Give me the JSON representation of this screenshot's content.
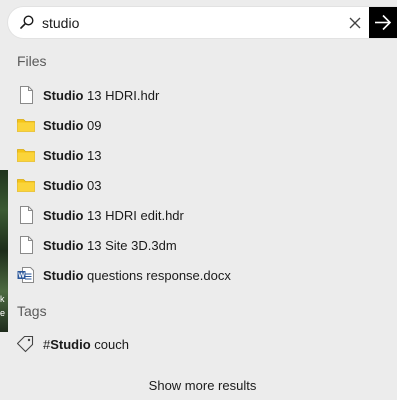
{
  "search": {
    "query": "studio",
    "submit_icon": "arrow-right-icon",
    "clear_icon": "close-icon"
  },
  "files_section": {
    "title": "Files",
    "items": [
      {
        "match": "Studio",
        "rest": " 13 HDRI.hdr",
        "icon": "file-icon"
      },
      {
        "match": "Studio",
        "rest": " 09",
        "icon": "folder-icon"
      },
      {
        "match": "Studio",
        "rest": " 13",
        "icon": "folder-icon"
      },
      {
        "match": "Studio",
        "rest": " 03",
        "icon": "folder-icon"
      },
      {
        "match": "Studio",
        "rest": " 13 HDRI edit.hdr",
        "icon": "file-icon"
      },
      {
        "match": "Studio",
        "rest": " 13 Site 3D.3dm",
        "icon": "file-icon"
      },
      {
        "match": "Studio",
        "rest": " questions response.docx",
        "icon": "word-doc-icon"
      }
    ]
  },
  "tags_section": {
    "title": "Tags",
    "items": [
      {
        "prefix": "#",
        "match": "Studio",
        "rest": " couch",
        "icon": "tag-icon"
      }
    ]
  },
  "show_more_label": "Show more results",
  "background": {
    "fragment_1": "k",
    "fragment_2": "e"
  },
  "colors": {
    "folder": "#f5c518",
    "word_blue": "#2b579a",
    "submit_bg": "#000000"
  }
}
